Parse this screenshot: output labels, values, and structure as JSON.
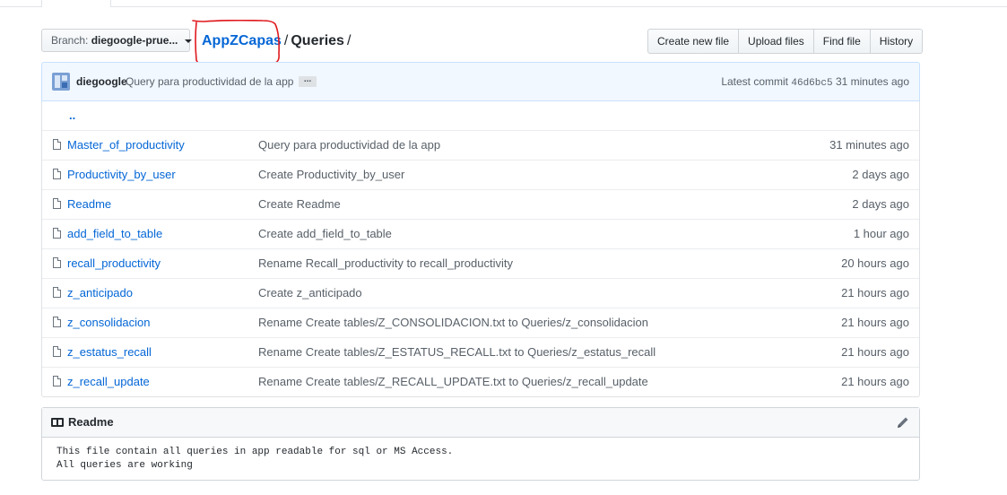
{
  "branch": {
    "label": "Branch:",
    "value": "diegoogle-prue..."
  },
  "breadcrumb": {
    "repo": "AppZCapas",
    "sep": "/",
    "dir": "Queries",
    "trail": "/"
  },
  "actions": {
    "create_new_file": "Create new file",
    "upload_files": "Upload files",
    "find_file": "Find file",
    "history": "History"
  },
  "commit": {
    "author": "diegoogle",
    "message": "Query para productividad de la app",
    "more": "...",
    "latest_label": "Latest commit",
    "sha": "46d6bc5",
    "age": "31 minutes ago"
  },
  "parent_dir": "..",
  "files": [
    {
      "name": "Master_of_productivity",
      "message": "Query para productividad de la app",
      "age": "31 minutes ago"
    },
    {
      "name": "Productivity_by_user",
      "message": "Create Productivity_by_user",
      "age": "2 days ago"
    },
    {
      "name": "Readme",
      "message": "Create Readme",
      "age": "2 days ago"
    },
    {
      "name": "add_field_to_table",
      "message": "Create add_field_to_table",
      "age": "1 hour ago"
    },
    {
      "name": "recall_productivity",
      "message": "Rename Recall_productivity to recall_productivity",
      "age": "20 hours ago"
    },
    {
      "name": "z_anticipado",
      "message": "Create z_anticipado",
      "age": "21 hours ago"
    },
    {
      "name": "z_consolidacion",
      "message": "Rename Create tables/Z_CONSOLIDACION.txt to Queries/z_consolidacion",
      "age": "21 hours ago"
    },
    {
      "name": "z_estatus_recall",
      "message": "Rename Create tables/Z_ESTATUS_RECALL.txt to Queries/z_estatus_recall",
      "age": "21 hours ago"
    },
    {
      "name": "z_recall_update",
      "message": "Rename Create tables/Z_RECALL_UPDATE.txt to Queries/z_recall_update",
      "age": "21 hours ago"
    }
  ],
  "readme": {
    "title": "Readme",
    "lines": [
      "This file contain all queries in app readable for sql or MS Access.",
      "All queries are working"
    ]
  },
  "colors": {
    "link": "#0366d6",
    "annotation": "#e0191e",
    "commit_bg": "#f1f8ff"
  },
  "icons": {
    "file": "file-icon",
    "book": "book-icon",
    "edit": "pencil-icon"
  }
}
